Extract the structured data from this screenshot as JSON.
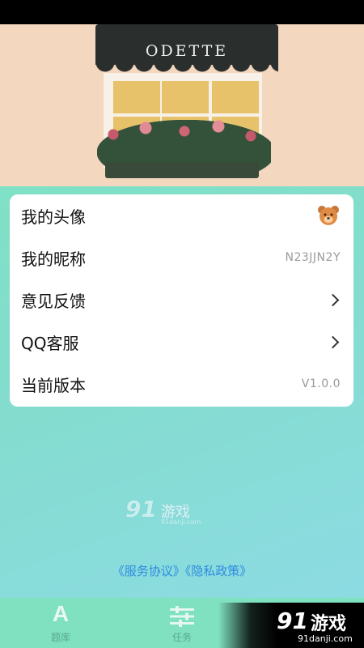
{
  "header": {
    "sign_text": "ODETTE"
  },
  "settings": {
    "items": [
      {
        "label": "我的头像",
        "value": "",
        "trailing": "avatar"
      },
      {
        "label": "我的昵称",
        "value": "N23JJN2Y",
        "trailing": "text"
      },
      {
        "label": "意见反馈",
        "value": "",
        "trailing": "chevron-right-icon"
      },
      {
        "label": "QQ客服",
        "value": "",
        "trailing": "chevron-right-icon"
      },
      {
        "label": "当前版本",
        "value": "V1.0.0",
        "trailing": "text"
      }
    ]
  },
  "watermark": {
    "brand_number": "91",
    "brand_text": "游戏",
    "url": "91danji.com"
  },
  "footer": {
    "policy_links": "《服务协议》《隐私政策》"
  },
  "tabbar": {
    "tabs": [
      {
        "icon": "letter-a-icon",
        "icon_text": "A",
        "label": "题库"
      },
      {
        "icon": "sliders-icon",
        "label": "任务"
      }
    ]
  },
  "corner_watermark": {
    "brand_number": "91",
    "brand_text": "游戏",
    "url": "91danji.com"
  },
  "colors": {
    "accent_link": "#2f8ce0",
    "tabbar_bg": "#7fe1bf",
    "card_bg": "#ffffff"
  }
}
